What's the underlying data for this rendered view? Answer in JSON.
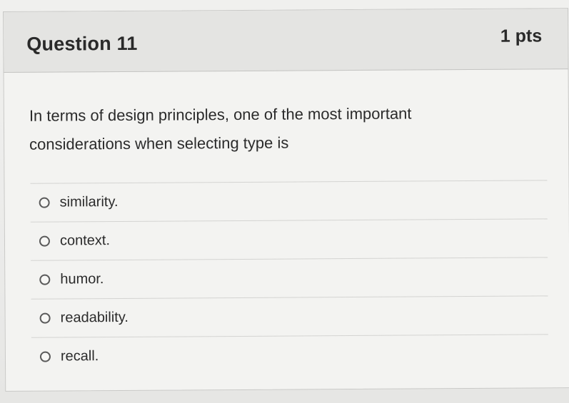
{
  "question": {
    "title": "Question 11",
    "points": "1 pts",
    "prompt": "In terms of design principles, one of the most important considerations when selecting type is"
  },
  "answers": [
    {
      "label": "similarity."
    },
    {
      "label": "context."
    },
    {
      "label": "humor."
    },
    {
      "label": "readability."
    },
    {
      "label": "recall."
    }
  ],
  "selected_answer": null,
  "colors": {
    "header_bg": "#e4e4e2",
    "text": "#2b2b2b",
    "border": "#c9c9c7"
  }
}
